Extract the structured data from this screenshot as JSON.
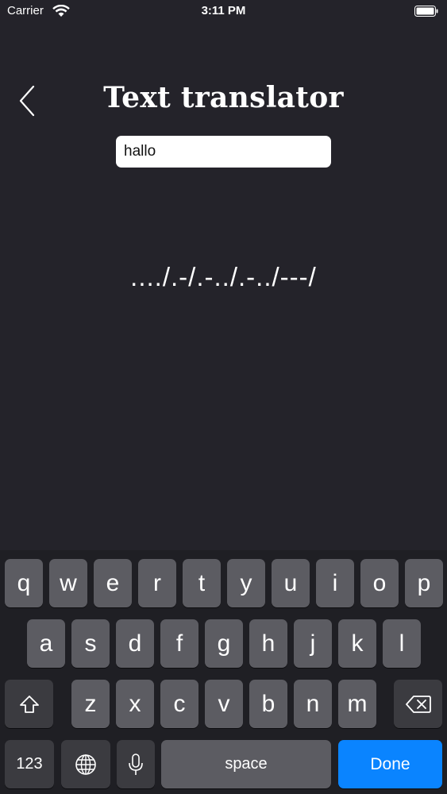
{
  "status_bar": {
    "carrier": "Carrier",
    "time": "3:11 PM"
  },
  "header": {
    "title": "Text translator",
    "back_icon": "chevron-left-icon"
  },
  "input": {
    "value": "hallo"
  },
  "output": {
    "morse": "..../.-/.-../.-../---/"
  },
  "keyboard": {
    "row1": [
      "q",
      "w",
      "e",
      "r",
      "t",
      "y",
      "u",
      "i",
      "o",
      "p"
    ],
    "row2": [
      "a",
      "s",
      "d",
      "f",
      "g",
      "h",
      "j",
      "k",
      "l"
    ],
    "row3": [
      "z",
      "x",
      "c",
      "v",
      "b",
      "n",
      "m"
    ],
    "numbers_label": "123",
    "space_label": "space",
    "done_label": "Done",
    "done_color": "#0a84ff"
  }
}
